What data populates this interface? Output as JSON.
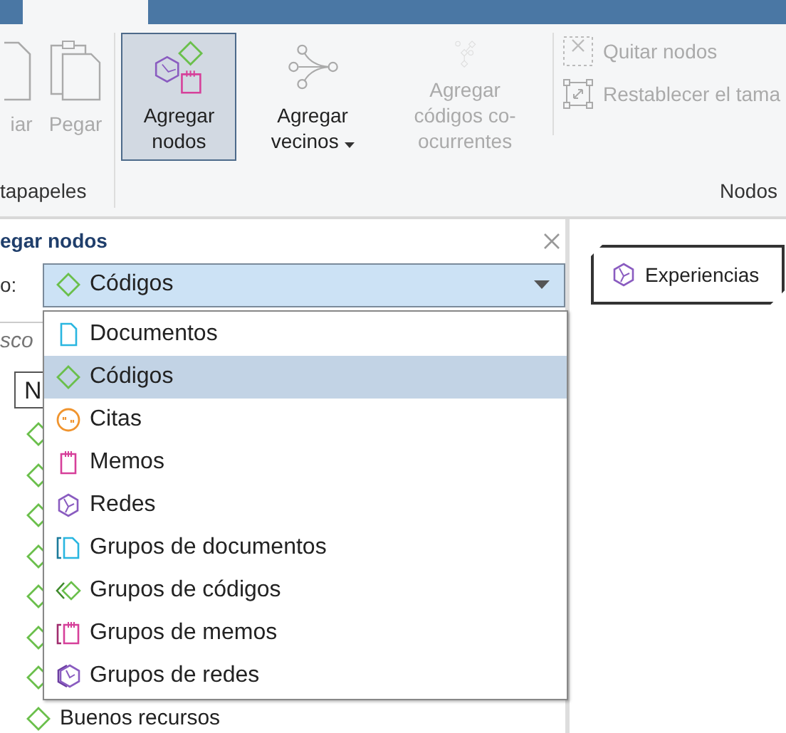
{
  "tabs": [
    {
      "selected": false
    },
    {
      "selected": true
    },
    {
      "selected": false
    },
    {
      "selected": false
    }
  ],
  "ribbon": {
    "groups": [
      {
        "label": "tapapeles",
        "buttons": [
          {
            "kind": "copy",
            "label": "iar",
            "disabled": true,
            "selected": false
          },
          {
            "kind": "paste",
            "label": "Pegar",
            "disabled": true,
            "selected": false
          }
        ]
      },
      {
        "label": "Nodos",
        "buttons": [
          {
            "kind": "add-nodes",
            "label": "Agregar nodos",
            "disabled": false,
            "selected": true
          },
          {
            "kind": "neighbors",
            "label": "Agregar vecinos",
            "disabled": false,
            "selected": false,
            "dropdown": true
          },
          {
            "kind": "cooccurring",
            "label": "Agregar códigos co-ocurrentes",
            "disabled": true,
            "selected": false
          }
        ],
        "small_buttons": [
          {
            "kind": "remove",
            "label": "Quitar nodos",
            "disabled": true
          },
          {
            "kind": "resize",
            "label": "Restablecer el tama",
            "disabled": true
          }
        ]
      }
    ]
  },
  "panel": {
    "title": "egar nodos",
    "type_label": "o:",
    "combo": {
      "kind": "code",
      "value": "Códigos"
    },
    "search": {
      "placeholder": "sco"
    },
    "header": "N",
    "dropdown": [
      {
        "kind": "document",
        "label": "Documentos",
        "selected": false
      },
      {
        "kind": "code",
        "label": "Códigos",
        "selected": true
      },
      {
        "kind": "quote",
        "label": "Citas",
        "selected": false
      },
      {
        "kind": "memo",
        "label": "Memos",
        "selected": false
      },
      {
        "kind": "network",
        "label": "Redes",
        "selected": false
      },
      {
        "kind": "document-group",
        "label": "Grupos de documentos",
        "selected": false
      },
      {
        "kind": "code-group",
        "label": "Grupos de códigos",
        "selected": false
      },
      {
        "kind": "memo-group",
        "label": "Grupos de memos",
        "selected": false
      },
      {
        "kind": "network-group",
        "label": "Grupos de redes",
        "selected": false
      }
    ],
    "list": [
      {
        "kind": "code"
      },
      {
        "kind": "code"
      },
      {
        "kind": "code"
      },
      {
        "kind": "code"
      },
      {
        "kind": "code"
      },
      {
        "kind": "code"
      },
      {
        "kind": "code"
      },
      {
        "kind": "code",
        "label": "Buenos recursos"
      }
    ]
  },
  "canvas": {
    "nodes": [
      {
        "kind": "network",
        "label": "Experiencias"
      }
    ]
  }
}
